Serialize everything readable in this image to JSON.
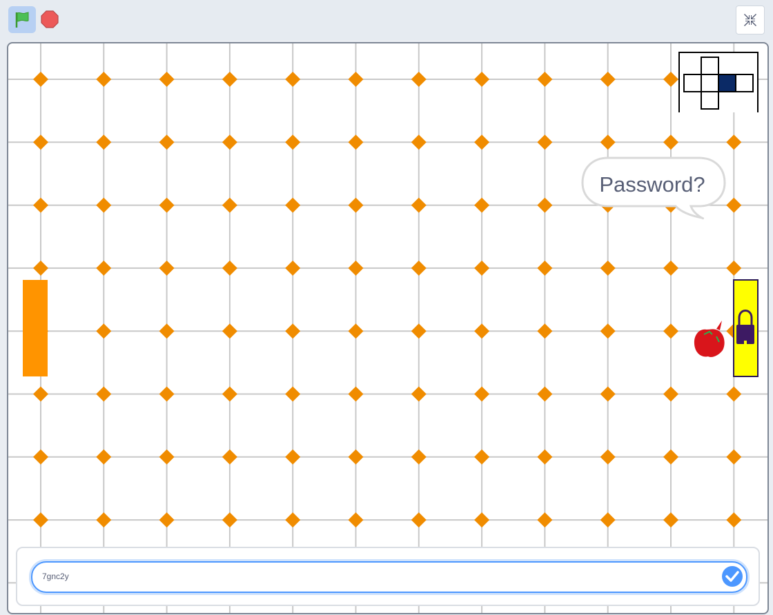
{
  "toolbar": {
    "green_flag": "green-flag-icon",
    "stop": "stop-sign-icon",
    "fullscreen_exit": "shrink-screen-icon"
  },
  "colors": {
    "grid_line": "#c8c8c8",
    "dot": "#f08c00",
    "door_left": "#ff9400",
    "door_right": "#ffff00",
    "lock": "#3d1a63",
    "map_active": "#0b2a66",
    "ask_border": "#4c97ff"
  },
  "stage": {
    "speech_bubble": "Password?",
    "minimap": {
      "cells": [
        {
          "col": 1,
          "row": 0,
          "active": false
        },
        {
          "col": 0,
          "row": 1,
          "active": false
        },
        {
          "col": 1,
          "row": 1,
          "active": false
        },
        {
          "col": 2,
          "row": 1,
          "active": true
        },
        {
          "col": 3,
          "row": 1,
          "active": false
        },
        {
          "col": 1,
          "row": 2,
          "active": false
        }
      ]
    }
  },
  "ask": {
    "answer_value": "7gnc2y",
    "submit_icon": "check-icon"
  }
}
